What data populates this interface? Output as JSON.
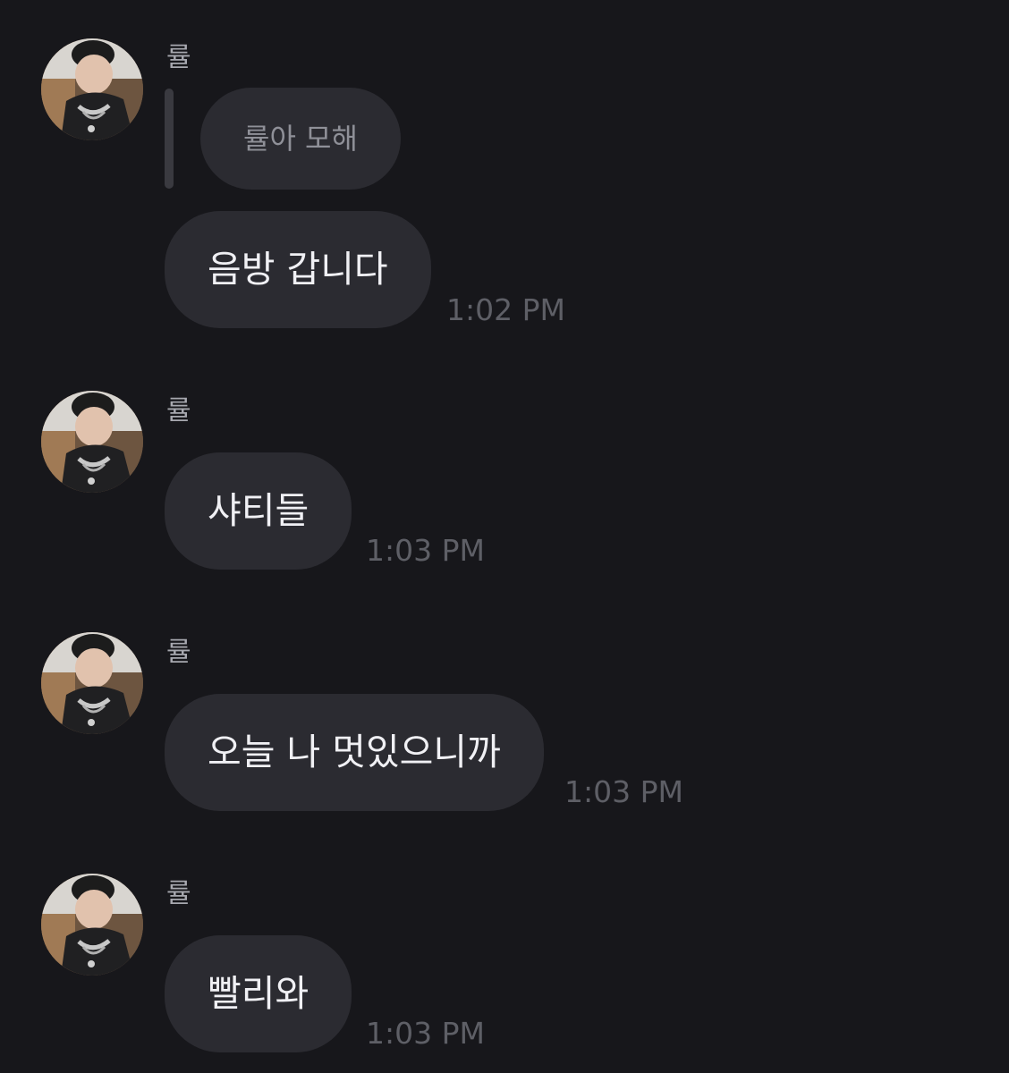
{
  "messages": [
    {
      "sender": "률",
      "avatar": "profile-photo",
      "quote": "률아 모해",
      "text": "음방 갑니다",
      "time": "1:02 PM"
    },
    {
      "sender": "률",
      "avatar": "profile-photo",
      "text": "샤티들",
      "time": "1:03 PM"
    },
    {
      "sender": "률",
      "avatar": "profile-photo",
      "text": "오늘 나 멋있으니까",
      "time": "1:03 PM"
    },
    {
      "sender": "률",
      "avatar": "profile-photo",
      "text": "빨리와",
      "time": "1:03 PM"
    }
  ],
  "colors": {
    "background": "#17171b",
    "bubble": "#2b2b31",
    "sender": "#a7a8af",
    "time": "#5e5f66",
    "quote_text": "#8f9098"
  }
}
